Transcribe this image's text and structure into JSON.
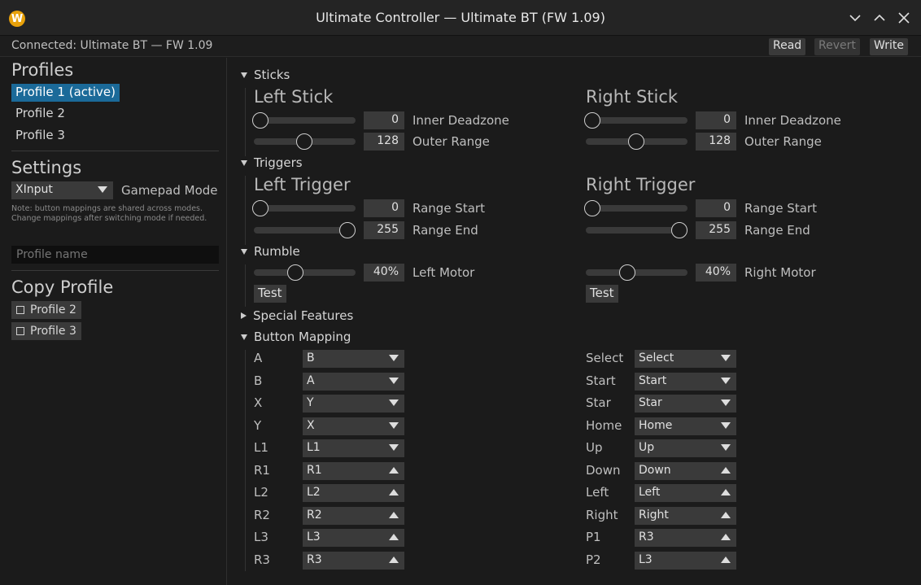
{
  "window": {
    "title": "Ultimate Controller — Ultimate BT (FW 1.09)",
    "app_icon_letter": "W"
  },
  "status": {
    "text": "Connected: Ultimate BT — FW 1.09",
    "read_label": "Read",
    "revert_label": "Revert",
    "write_label": "Write"
  },
  "sidebar": {
    "profiles_heading": "Profiles",
    "profiles": [
      "Profile 1 (active)",
      "Profile 2",
      "Profile 3"
    ],
    "settings_heading": "Settings",
    "mode_value": "XInput",
    "mode_label": "Gamepad Mode",
    "note": "Note: button mappings are shared across modes. Change mappings after switching mode if needed.",
    "profile_name_placeholder": "Profile name",
    "copy_heading": "Copy Profile",
    "copy_targets": [
      "Profile 2",
      "Profile 3"
    ]
  },
  "sticks": {
    "section": "Sticks",
    "left_title": "Left Stick",
    "right_title": "Right Stick",
    "left_deadzone": "0",
    "left_range": "128",
    "right_deadzone": "0",
    "right_range": "128",
    "deadzone_label": "Inner Deadzone",
    "range_label": "Outer Range"
  },
  "triggers": {
    "section": "Triggers",
    "left_title": "Left Trigger",
    "right_title": "Right Trigger",
    "left_start": "0",
    "left_end": "255",
    "right_start": "0",
    "right_end": "255",
    "start_label": "Range Start",
    "end_label": "Range End"
  },
  "rumble": {
    "section": "Rumble",
    "left_value": "40%",
    "right_value": "40%",
    "left_label": "Left Motor",
    "right_label": "Right Motor",
    "test_label": "Test"
  },
  "special_features": {
    "section": "Special Features"
  },
  "button_mapping": {
    "section": "Button Mapping",
    "left": [
      {
        "button": "A",
        "mapped": "B"
      },
      {
        "button": "B",
        "mapped": "A"
      },
      {
        "button": "X",
        "mapped": "Y"
      },
      {
        "button": "Y",
        "mapped": "X"
      },
      {
        "button": "L1",
        "mapped": "L1"
      },
      {
        "button": "R1",
        "mapped": "R1"
      },
      {
        "button": "L2",
        "mapped": "L2"
      },
      {
        "button": "R2",
        "mapped": "R2"
      },
      {
        "button": "L3",
        "mapped": "L3"
      },
      {
        "button": "R3",
        "mapped": "R3"
      }
    ],
    "right": [
      {
        "button": "Select",
        "mapped": "Select"
      },
      {
        "button": "Start",
        "mapped": "Start"
      },
      {
        "button": "Star",
        "mapped": "Star"
      },
      {
        "button": "Home",
        "mapped": "Home"
      },
      {
        "button": "Up",
        "mapped": "Up"
      },
      {
        "button": "Down",
        "mapped": "Down"
      },
      {
        "button": "Left",
        "mapped": "Left"
      },
      {
        "button": "Right",
        "mapped": "Right"
      },
      {
        "button": "P1",
        "mapped": "R3"
      },
      {
        "button": "P2",
        "mapped": "L3"
      }
    ]
  }
}
